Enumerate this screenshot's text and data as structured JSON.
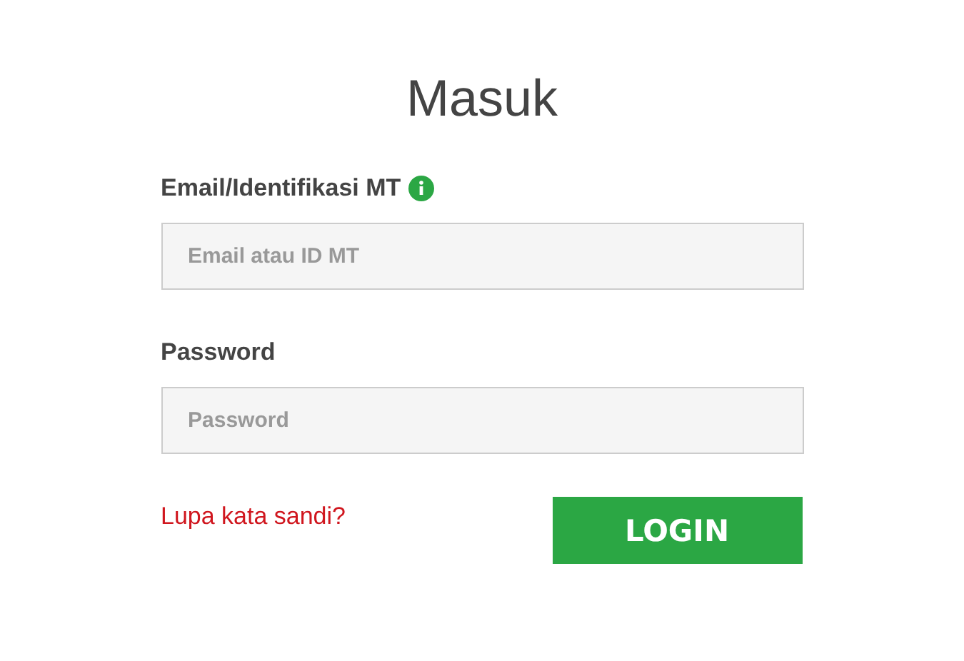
{
  "title": "Masuk",
  "fields": [
    {
      "label": "Email/Identifikasi MT",
      "info": true,
      "placeholder": "Email atau ID MT"
    },
    {
      "label": "Password",
      "info": false,
      "placeholder": "Password"
    }
  ],
  "forgot_link": "Lupa kata sandi?",
  "login_button": "LOGIN"
}
